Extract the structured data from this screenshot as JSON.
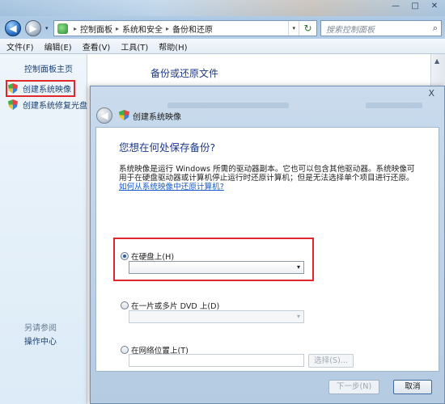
{
  "window": {
    "minimize_glyph": "—",
    "maximize_glyph": "□",
    "close_glyph": "✕"
  },
  "nav": {
    "back_glyph": "◀",
    "forward_glyph": "▶",
    "recent_glyph": "▾"
  },
  "address": {
    "crumbs": [
      "控制面板",
      "系统和安全",
      "备份和还原"
    ],
    "separator": "▸",
    "dropdown_glyph": "▾",
    "refresh_glyph": "↻"
  },
  "search": {
    "placeholder": "搜索控制面板",
    "icon": "⌕"
  },
  "menu": {
    "items": [
      "文件(F)",
      "编辑(E)",
      "查看(V)",
      "工具(T)",
      "帮助(H)"
    ]
  },
  "left_pane": {
    "home_link": "控制面板主页",
    "items": [
      "创建系统映像",
      "创建系统修复光盘"
    ],
    "see_also": "另请参阅",
    "action_center": "操作中心"
  },
  "main": {
    "title": "备份或还原文件"
  },
  "dialog": {
    "close_glyph": "X",
    "back_glyph": "◀",
    "title": "创建系统映像",
    "heading": "您想在何处保存备份?",
    "description": "系统映像是运行 Windows 所需的驱动器副本。它也可以包含其他驱动器。系统映像可用于在硬盘驱动器或计算机停止运行时还原计算机；但是无法选择单个项目进行还原。",
    "help_link": "如何从系统映像中还原计算机?",
    "options": {
      "hard_disk": {
        "label": "在硬盘上(H)",
        "selected": true,
        "value": ""
      },
      "dvd": {
        "label": "在一片或多片 DVD 上(D)",
        "selected": false,
        "value": ""
      },
      "network": {
        "label": "在网络位置上(T)",
        "selected": false,
        "value": ""
      }
    },
    "select_button": "选择(S)...",
    "next_button": "下一步(N)",
    "cancel_button": "取消",
    "combo_arrow": "▾"
  }
}
